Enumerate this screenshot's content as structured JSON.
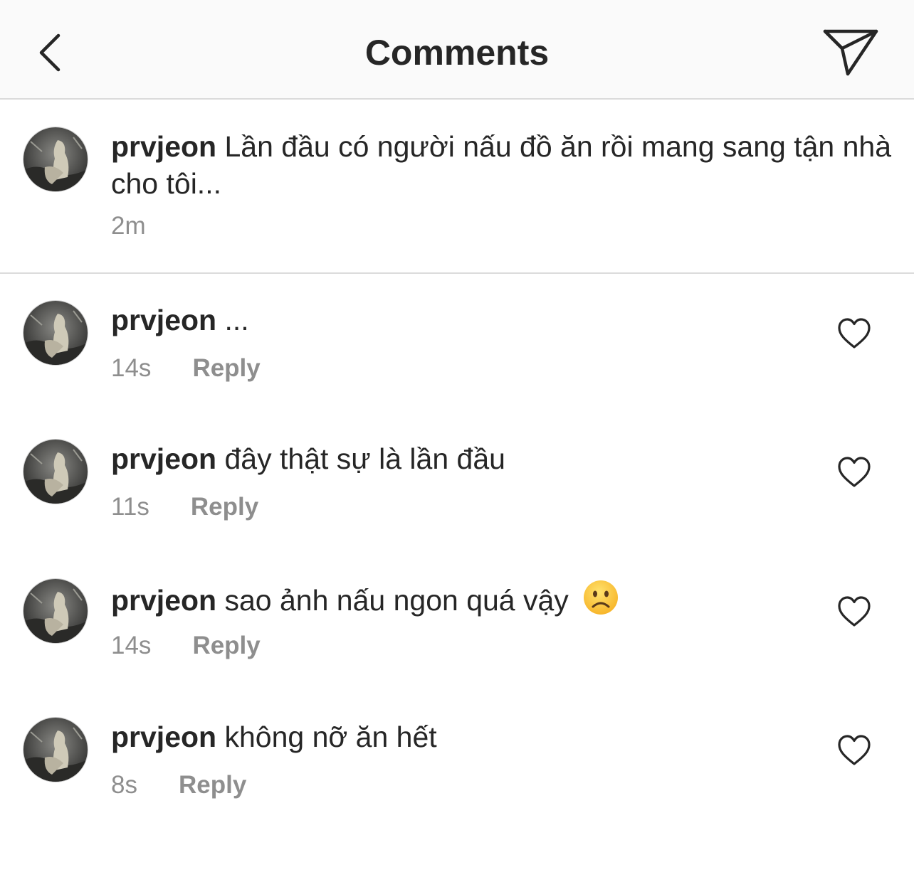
{
  "header": {
    "title": "Comments"
  },
  "caption": {
    "username": "prvjeon",
    "text": "Lần đầu có người nấu đồ ăn rồi mang sang tận nhà cho tôi...",
    "time": "2m"
  },
  "comments": [
    {
      "username": "prvjeon",
      "text": "...",
      "time": "14s",
      "reply_label": "Reply"
    },
    {
      "username": "prvjeon",
      "text": "đây thật sự là lần đầu",
      "time": "11s",
      "reply_label": "Reply"
    },
    {
      "username": "prvjeon",
      "text": "sao ảnh nấu ngon quá vậy",
      "emoji": "frowning-face",
      "time": "14s",
      "reply_label": "Reply"
    },
    {
      "username": "prvjeon",
      "text": "không nỡ ăn hết",
      "time": "8s",
      "reply_label": "Reply"
    }
  ],
  "colors": {
    "text": "#262626",
    "secondary_text": "#8e8e8e",
    "divider": "#dbdbdb",
    "header_bg": "#fafafa"
  }
}
